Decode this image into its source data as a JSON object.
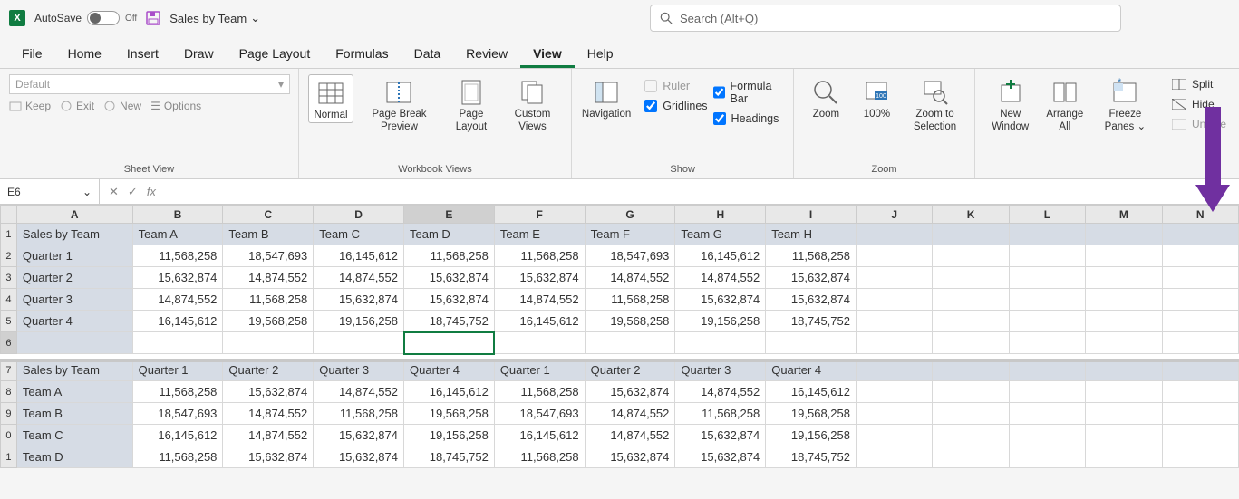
{
  "title": {
    "autosave": "AutoSave",
    "autosave_state": "Off",
    "filename": "Sales by Team",
    "search_placeholder": "Search (Alt+Q)"
  },
  "tabs": [
    "File",
    "Home",
    "Insert",
    "Draw",
    "Page Layout",
    "Formulas",
    "Data",
    "Review",
    "View",
    "Help"
  ],
  "active_tab": "View",
  "ribbon": {
    "sheetview": {
      "default": "Default",
      "keep": "Keep",
      "exit": "Exit",
      "new": "New",
      "options": "Options",
      "label": "Sheet View"
    },
    "wbviews": {
      "normal": "Normal",
      "pbp": "Page Break Preview",
      "pl": "Page Layout",
      "cv": "Custom Views",
      "label": "Workbook Views"
    },
    "nav": {
      "nav": "Navigation"
    },
    "show": {
      "ruler": "Ruler",
      "gridlines": "Gridlines",
      "formula": "Formula Bar",
      "headings": "Headings",
      "label": "Show"
    },
    "zoom": {
      "zoom": "Zoom",
      "z100": "100%",
      "zsel": "Zoom to Selection",
      "label": "Zoom"
    },
    "window": {
      "nw": "New Window",
      "aa": "Arrange All",
      "fp": "Freeze Panes",
      "split": "Split",
      "hide": "Hide",
      "unhide": "Unhide"
    }
  },
  "fbar": {
    "name": "E6",
    "fx": "fx"
  },
  "cols": [
    "A",
    "B",
    "C",
    "D",
    "E",
    "F",
    "G",
    "H",
    "I",
    "J",
    "K",
    "L",
    "M",
    "N"
  ],
  "top": {
    "rows": [
      "1",
      "2",
      "3",
      "4",
      "5",
      "6"
    ],
    "data": [
      [
        "Sales by Team",
        "Team A",
        "Team B",
        "Team C",
        "Team D",
        "Team E",
        "Team F",
        "Team G",
        "Team H",
        "",
        "",
        "",
        "",
        ""
      ],
      [
        "Quarter 1",
        "11,568,258",
        "18,547,693",
        "16,145,612",
        "11,568,258",
        "11,568,258",
        "18,547,693",
        "16,145,612",
        "11,568,258",
        "",
        "",
        "",
        "",
        ""
      ],
      [
        "Quarter 2",
        "15,632,874",
        "14,874,552",
        "14,874,552",
        "15,632,874",
        "15,632,874",
        "14,874,552",
        "14,874,552",
        "15,632,874",
        "",
        "",
        "",
        "",
        ""
      ],
      [
        "Quarter 3",
        "14,874,552",
        "11,568,258",
        "15,632,874",
        "15,632,874",
        "14,874,552",
        "11,568,258",
        "15,632,874",
        "15,632,874",
        "",
        "",
        "",
        "",
        ""
      ],
      [
        "Quarter 4",
        "16,145,612",
        "19,568,258",
        "19,156,258",
        "18,745,752",
        "16,145,612",
        "19,568,258",
        "19,156,258",
        "18,745,752",
        "",
        "",
        "",
        "",
        ""
      ],
      [
        "",
        "",
        "",
        "",
        "",
        "",
        "",
        "",
        "",
        "",
        "",
        "",
        "",
        ""
      ]
    ]
  },
  "bot": {
    "rows": [
      "7",
      "8",
      "9",
      "0",
      "1"
    ],
    "data": [
      [
        "Sales by Team",
        "Quarter 1",
        "Quarter 2",
        "Quarter 3",
        "Quarter 4",
        "Quarter 1",
        "Quarter 2",
        "Quarter 3",
        "Quarter 4",
        "",
        "",
        "",
        "",
        ""
      ],
      [
        "Team A",
        "11,568,258",
        "15,632,874",
        "14,874,552",
        "16,145,612",
        "11,568,258",
        "15,632,874",
        "14,874,552",
        "16,145,612",
        "",
        "",
        "",
        "",
        ""
      ],
      [
        "Team B",
        "18,547,693",
        "14,874,552",
        "11,568,258",
        "19,568,258",
        "18,547,693",
        "14,874,552",
        "11,568,258",
        "19,568,258",
        "",
        "",
        "",
        "",
        ""
      ],
      [
        "Team C",
        "16,145,612",
        "14,874,552",
        "15,632,874",
        "19,156,258",
        "16,145,612",
        "14,874,552",
        "15,632,874",
        "19,156,258",
        "",
        "",
        "",
        "",
        ""
      ],
      [
        "Team D",
        "11,568,258",
        "15,632,874",
        "15,632,874",
        "18,745,752",
        "11,568,258",
        "15,632,874",
        "15,632,874",
        "18,745,752",
        "",
        "",
        "",
        "",
        ""
      ]
    ]
  }
}
